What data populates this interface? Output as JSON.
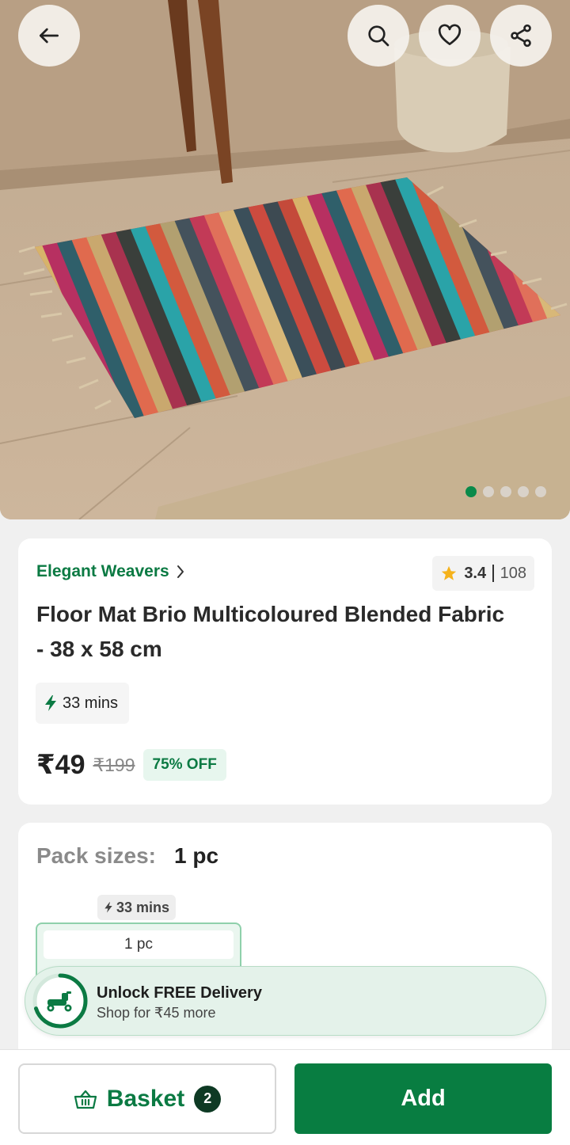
{
  "header": {
    "back_icon": "arrow-left-icon",
    "search_icon": "search-icon",
    "wishlist_icon": "heart-icon",
    "share_icon": "share-icon"
  },
  "gallery": {
    "total_images": 5,
    "active_index": 0
  },
  "product": {
    "brand": "Elegant Weavers",
    "brand_arrow": "›",
    "rating": "3.4",
    "rating_count": "108",
    "title": "Floor Mat Brio Multicoloured Blended Fabric - 38 x 58 cm",
    "delivery_eta": "33 mins",
    "price": "₹49",
    "mrp": "₹199",
    "discount": "75% OFF"
  },
  "pack_sizes": {
    "label": "Pack sizes:",
    "selected": "1 pc",
    "options": [
      {
        "eta": "33 mins",
        "size": "1 pc"
      }
    ]
  },
  "free_delivery": {
    "title": "Unlock FREE Delivery",
    "subtitle": "Shop for ₹45 more",
    "progress_fraction": 0.7
  },
  "footer": {
    "basket_label": "Basket",
    "basket_count": "2",
    "add_label": "Add"
  },
  "colors": {
    "brand_green": "#0b7a43",
    "add_button": "#087d41",
    "star": "#f5b21b"
  }
}
